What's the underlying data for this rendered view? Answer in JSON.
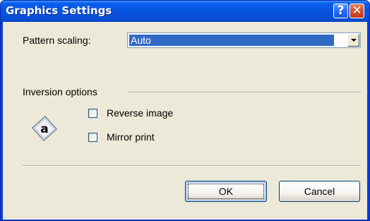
{
  "window": {
    "title": "Graphics Settings",
    "help_glyph": "?",
    "close_glyph": "✕"
  },
  "pattern_scaling": {
    "label": "Pattern scaling:",
    "selected": "Auto"
  },
  "inversion": {
    "group_label": "Inversion options",
    "icon_glyph": "a",
    "reverse_image_label": "Reverse image",
    "reverse_image_checked": false,
    "mirror_print_label": "Mirror print",
    "mirror_print_checked": false
  },
  "buttons": {
    "ok_label": "OK",
    "cancel_label": "Cancel"
  },
  "colors": {
    "title_bar": "#0654e0",
    "dialog_face": "#ece9d8",
    "selection": "#316ac5",
    "close_button": "#d4512c"
  }
}
